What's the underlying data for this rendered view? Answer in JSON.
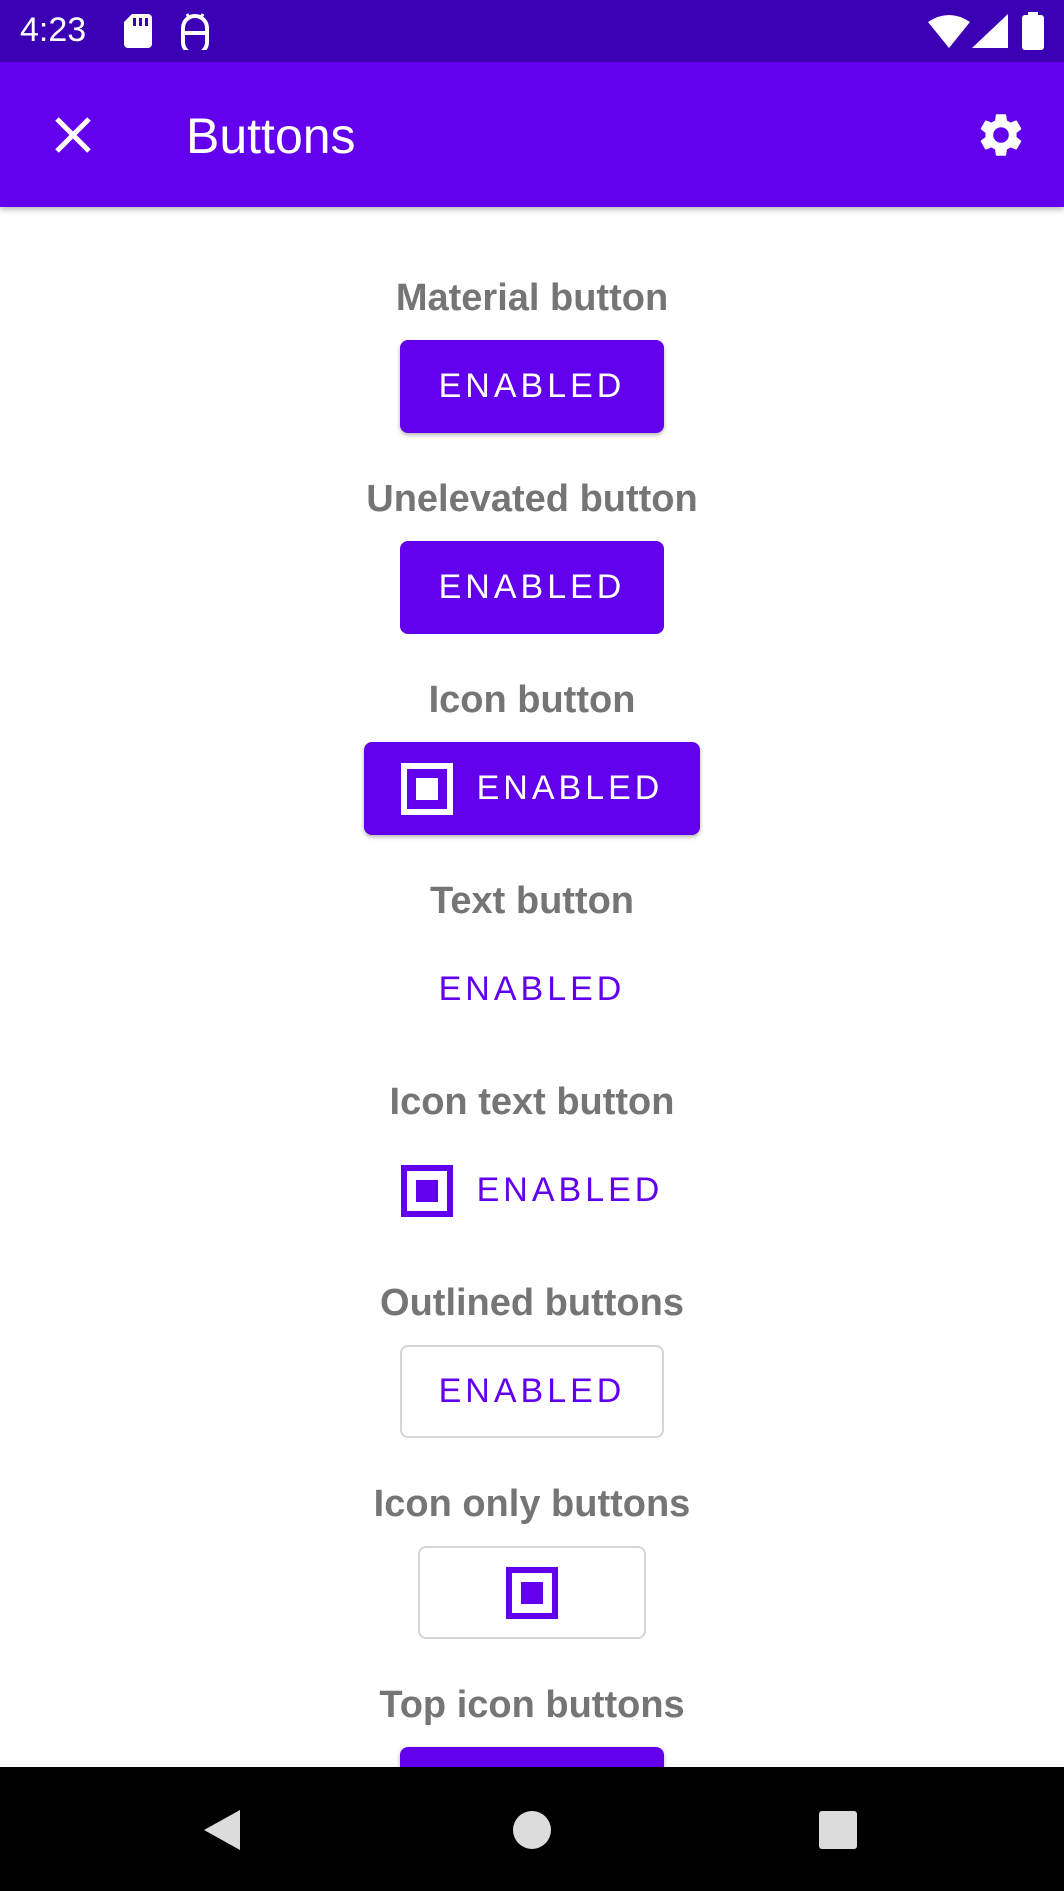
{
  "status_bar": {
    "time": "4:23",
    "icons": [
      "sd-card-icon",
      "debug-icon",
      "wifi-icon",
      "cell-signal-icon",
      "battery-icon"
    ]
  },
  "app_bar": {
    "title": "Buttons",
    "close_icon": "close-icon",
    "settings_icon": "gear-icon",
    "background": "#6200ee"
  },
  "colors": {
    "primary": "#6200ee",
    "status_bar": "#3b00b4",
    "section_title": "#757575",
    "outline": "#d6d6d6"
  },
  "sections": [
    {
      "title": "Material button",
      "button_label": "ENABLED"
    },
    {
      "title": "Unelevated button",
      "button_label": "ENABLED"
    },
    {
      "title": "Icon button",
      "button_label": "ENABLED",
      "icon": "square-icon"
    },
    {
      "title": "Text button",
      "button_label": "ENABLED"
    },
    {
      "title": "Icon text button",
      "button_label": "ENABLED",
      "icon": "square-icon"
    },
    {
      "title": "Outlined buttons",
      "button_label": "ENABLED"
    },
    {
      "title": "Icon only buttons",
      "icon": "square-icon"
    },
    {
      "title": "Top icon buttons"
    }
  ],
  "nav_bar": {
    "icons": [
      "back-icon",
      "home-icon",
      "recents-icon"
    ]
  }
}
